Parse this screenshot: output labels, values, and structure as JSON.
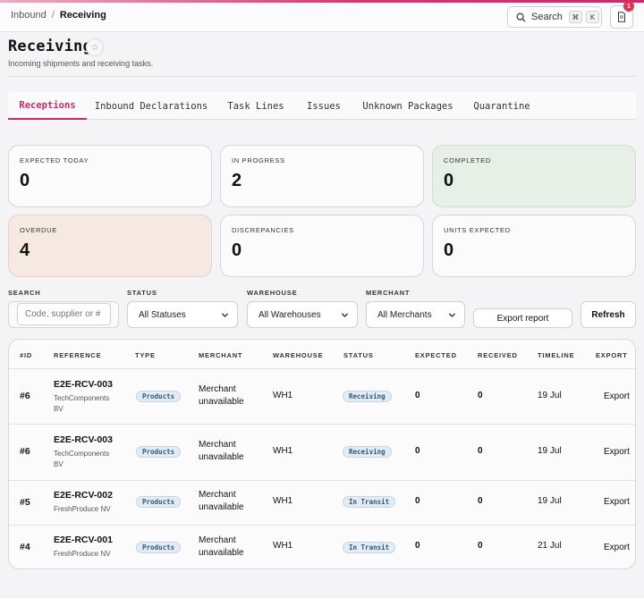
{
  "breadcrumb": {
    "root": "Inbound",
    "separator": "/",
    "current": "Receiving"
  },
  "topbar": {
    "search_label": "Search",
    "shortcut_mod": "⌘",
    "shortcut_key": "K",
    "notification_count": "1"
  },
  "page": {
    "title": "Receiving",
    "subtitle": "Incoming shipments and receiving tasks."
  },
  "tabs": [
    "Receptions",
    "Inbound Declarations",
    "Task Lines",
    "Issues",
    "Unknown Packages",
    "Quarantine"
  ],
  "active_tab": "Receptions",
  "stats": [
    {
      "label": "EXPECTED TODAY",
      "value": "0"
    },
    {
      "label": "IN PROGRESS",
      "value": "2"
    },
    {
      "label": "COMPLETED",
      "value": "0"
    },
    {
      "label": "OVERDUE",
      "value": "4"
    },
    {
      "label": "DISCREPANCIES",
      "value": "0"
    },
    {
      "label": "UNITS EXPECTED",
      "value": "0"
    }
  ],
  "filters": {
    "search_label": "SEARCH",
    "search_placeholder": "Code, supplier or #",
    "status_label": "STATUS",
    "status_value": "All Statuses",
    "warehouse_label": "WAREHOUSE",
    "warehouse_value": "All Warehouses",
    "merchant_label": "MERCHANT",
    "merchant_value": "All Merchants",
    "export_label": "Export report",
    "refresh_label": "Refresh"
  },
  "table": {
    "columns": [
      "#ID",
      "REFERENCE",
      "TYPE",
      "MERCHANT",
      "WAREHOUSE",
      "STATUS",
      "EXPECTED",
      "RECEIVED",
      "TIMELINE",
      "EXPORT"
    ],
    "rows": [
      {
        "id": "#6",
        "reference": "E2E-RCV-003",
        "supplier": "TechComponents BV",
        "type": "Products",
        "merchant": "Merchant unavailable",
        "warehouse": "WH1",
        "status": "Receiving",
        "expected": "0",
        "received": "0",
        "timeline": "19 Jul",
        "export": "Export"
      },
      {
        "id": "#6",
        "reference": "E2E-RCV-003",
        "supplier": "TechComponents BV",
        "type": "Products",
        "merchant": "Merchant unavailable",
        "warehouse": "WH1",
        "status": "Receiving",
        "expected": "0",
        "received": "0",
        "timeline": "19 Jul",
        "export": "Export"
      },
      {
        "id": "#5",
        "reference": "E2E-RCV-002",
        "supplier": "FreshProduce NV",
        "type": "Products",
        "merchant": "Merchant unavailable",
        "warehouse": "WH1",
        "status": "In Transit",
        "expected": "0",
        "received": "0",
        "timeline": "19 Jul",
        "export": "Export"
      },
      {
        "id": "#4",
        "reference": "E2E-RCV-001",
        "supplier": "FreshProduce NV",
        "type": "Products",
        "merchant": "Merchant unavailable",
        "warehouse": "WH1",
        "status": "In Transit",
        "expected": "0",
        "received": "0",
        "timeline": "21 Jul",
        "export": "Export"
      }
    ]
  },
  "colors": {
    "accent": "#d6246a",
    "completed_bg": "#e6f0e6",
    "overdue_bg": "#f5e9e2",
    "pill_bg": "#e3ecf3"
  }
}
